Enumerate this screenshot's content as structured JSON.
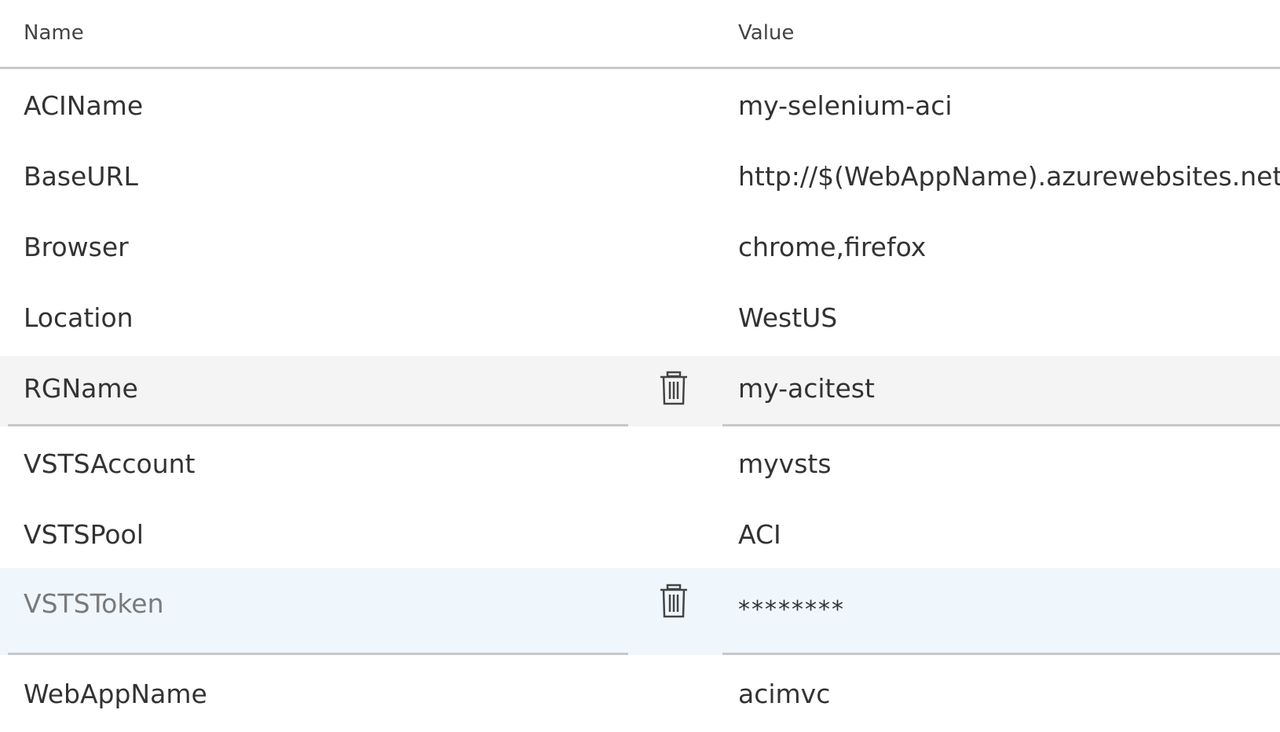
{
  "header": {
    "name_label": "Name",
    "value_label": "Value"
  },
  "rows": [
    {
      "name": "ACIName",
      "value": "my-selenium-aci"
    },
    {
      "name": "BaseURL",
      "value": "http://$(WebAppName).azurewebsites.net"
    },
    {
      "name": "Browser",
      "value": "chrome,firefox"
    },
    {
      "name": "Location",
      "value": "WestUS"
    },
    {
      "name": "RGName",
      "value": "my-acitest",
      "state": "hover",
      "delete_icon": "trash-icon"
    },
    {
      "name": "VSTSAccount",
      "value": "myvsts"
    },
    {
      "name": "VSTSPool",
      "value": "ACI"
    },
    {
      "name": "VSTSToken",
      "value": "********",
      "state": "selected",
      "secret": true,
      "delete_icon": "trash-icon"
    },
    {
      "name": "WebAppName",
      "value": "acimvc"
    }
  ],
  "colors": {
    "hover_row": "#f4f4f4",
    "selected_row": "#eff6fc",
    "divider": "#c8c8c8",
    "text": "#333333",
    "dim_text": "#7a7a7a"
  }
}
